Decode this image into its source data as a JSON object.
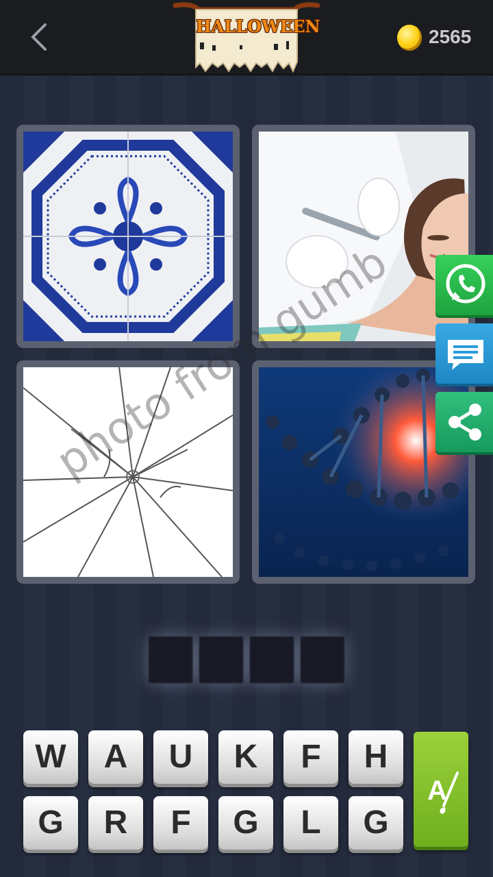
{
  "header": {
    "back_icon": "back-chevron-icon",
    "banner_text": "HALLOWEEN",
    "coin_icon": "gold-coin-icon",
    "coins": "2565"
  },
  "puzzle": {
    "images": [
      {
        "icon": "blue-ornamental-tile-image"
      },
      {
        "icon": "dermatology-treatment-image"
      },
      {
        "icon": "cracked-glass-image"
      },
      {
        "icon": "dna-helix-image"
      }
    ],
    "answer_slots": 4
  },
  "watermark": "photo from gumb",
  "side_buttons": {
    "whatsapp_icon": "whatsapp-icon",
    "message_icon": "message-icon",
    "share_icon": "share-icon"
  },
  "letters": {
    "row1": [
      "W",
      "A",
      "U",
      "K",
      "F",
      "H"
    ],
    "row2": [
      "G",
      "R",
      "F",
      "G",
      "L",
      "G"
    ]
  },
  "hint": {
    "label": "A",
    "icon": "magic-brush-icon"
  },
  "colors": {
    "whatsapp": "#25d366",
    "message": "#2b9bd8",
    "share": "#23ad6b",
    "hint": "#8cc63f",
    "banner_text": "#f08a14"
  }
}
